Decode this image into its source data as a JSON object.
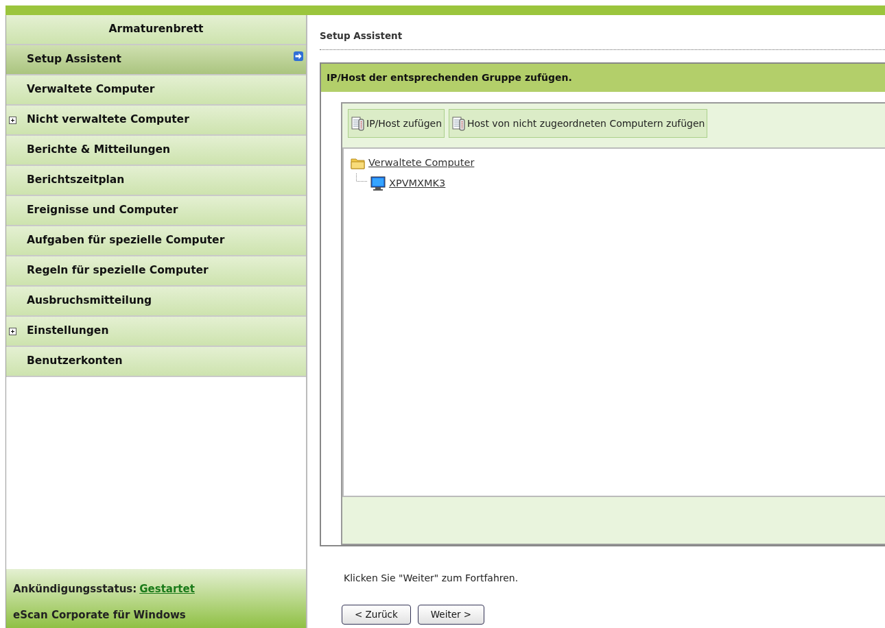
{
  "sidebar": {
    "title": "Armaturenbrett",
    "items": [
      {
        "label": "Setup Assistent",
        "selected": true,
        "expandable": false
      },
      {
        "label": "Verwaltete Computer",
        "selected": false,
        "expandable": false
      },
      {
        "label": "Nicht verwaltete Computer",
        "selected": false,
        "expandable": true
      },
      {
        "label": "Berichte & Mitteilungen",
        "selected": false,
        "expandable": false
      },
      {
        "label": "Berichtszeitplan",
        "selected": false,
        "expandable": false
      },
      {
        "label": "Ereignisse und Computer",
        "selected": false,
        "expandable": false
      },
      {
        "label": "Aufgaben für spezielle Computer",
        "selected": false,
        "expandable": false
      },
      {
        "label": "Regeln für spezielle Computer",
        "selected": false,
        "expandable": false
      },
      {
        "label": "Ausbruchsmitteilung",
        "selected": false,
        "expandable": false
      },
      {
        "label": "Einstellungen",
        "selected": false,
        "expandable": true
      },
      {
        "label": "Benutzerkonten",
        "selected": false,
        "expandable": false
      }
    ],
    "status_label": "Ankündigungsstatus:",
    "status_value": "Gestartet",
    "product": "eScan Corporate für Windows"
  },
  "page_title": "Setup Assistent",
  "panel": {
    "header": "IP/Host der entsprechenden Gruppe zufügen.",
    "toolbar": [
      "IP/Host zufügen",
      "Host von nicht zugeordneten Computern zufügen"
    ],
    "tree": [
      {
        "label": "Verwaltete Computer",
        "kind": "folder",
        "children": [
          {
            "label": "XPVMXMK3",
            "kind": "computer"
          }
        ]
      }
    ]
  },
  "hint": "Klicken Sie \"Weiter\" zum Fortfahren.",
  "buttons": [
    "< Zurück",
    "Weiter >"
  ]
}
